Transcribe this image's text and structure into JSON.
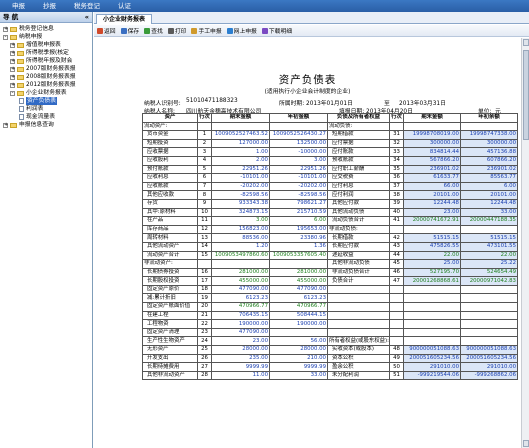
{
  "menu": [
    "申报",
    "抄报",
    "税务登记",
    "认证"
  ],
  "sidebar": {
    "title": "导 航",
    "nodes": [
      {
        "label": "税务登记信息",
        "exp": "+",
        "level": 0
      },
      {
        "label": "纳税申报",
        "exp": "-",
        "level": 0
      },
      {
        "label": "增值税申报表",
        "exp": "+",
        "level": 1
      },
      {
        "label": "所得税季报(核定",
        "exp": "+",
        "level": 1
      },
      {
        "label": "所得税年报及财会",
        "exp": "+",
        "level": 1
      },
      {
        "label": "2007版财务报表报",
        "exp": "+",
        "level": 1
      },
      {
        "label": "2008版财务报表报",
        "exp": "+",
        "level": 1
      },
      {
        "label": "2012版财务报表报",
        "exp": "+",
        "level": 1
      },
      {
        "label": "小企业财务报表",
        "exp": "-",
        "level": 1
      },
      {
        "label": "资产负债表",
        "exp": "",
        "level": 2,
        "selected": true
      },
      {
        "label": "利润表",
        "exp": "",
        "level": 2
      },
      {
        "label": "现金流量表",
        "exp": "",
        "level": 2
      },
      {
        "label": "申报信息查询",
        "exp": "+",
        "level": 0
      }
    ]
  },
  "tab": "小企业财务报表",
  "toolbar": [
    {
      "label": "返回",
      "color": "#d04a2c"
    },
    {
      "label": "保存",
      "color": "#3a6fc2"
    },
    {
      "label": "查找",
      "color": "#3a9b3a"
    },
    {
      "label": "打印",
      "color": "#5a5a5a"
    },
    {
      "label": "手工申报",
      "color": "#d09a2c"
    },
    {
      "label": "网上申报",
      "color": "#2c7fd0"
    },
    {
      "label": "下载明细",
      "color": "#7a4ac2"
    }
  ],
  "report": {
    "title": "资产负债表",
    "subtitle": "(适用执行小企业会计制度的企业)",
    "taxid_label": "纳税人识别号:",
    "taxid": "51010471188323",
    "period_label": "所属时期:",
    "period_from": "2013年01月01日",
    "period_to_label": "至",
    "period_to": "2013年03月31日",
    "name_label": "纳税人名称:",
    "name": "四川航天金穗高技术有限公司",
    "date_label": "填报日期:",
    "date": "2013年04月20日",
    "unit_label": "单位:",
    "unit": "元"
  },
  "table": {
    "headers": [
      "资产",
      "行次",
      "期末金额",
      "年初金额",
      "负债及所有者权益",
      "行次",
      "期末金额",
      "年初余额"
    ],
    "rows": [
      [
        "流动资产:",
        "",
        "",
        "",
        "流动负债:",
        "",
        "",
        ""
      ],
      [
        "货币资金",
        "1",
        "1009052527463.52",
        "1009052526430.27",
        "短期借款",
        "31",
        "19998708019.00",
        "19998747338.00"
      ],
      [
        "短期投资",
        "2",
        "127000.00",
        "132500.00",
        "应付票据",
        "32",
        "300000.00",
        "300000.00"
      ],
      [
        "应收票据",
        "3",
        "1.00",
        "-10000.00",
        "应付账款",
        "33",
        "834814.44",
        "457136.88"
      ],
      [
        "应收股利",
        "4",
        "2.00",
        "3.00",
        "预收账款",
        "34",
        "567866.20",
        "607866.20"
      ],
      [
        "预付账款",
        "5",
        "22951.26",
        "22951.26",
        "应付职工薪酬",
        "35",
        "236901.02",
        "236901.02"
      ],
      [
        "应收利息",
        "6",
        "-10101.00",
        "-10101.00",
        "应交税费",
        "36",
        "61633.77",
        "85563.77"
      ],
      [
        "应收账款",
        "7",
        "-20202.00",
        "-20202.00",
        "应付利息",
        "37",
        "66.00",
        "6.00"
      ],
      [
        "其他应收款",
        "8",
        "-82598.56",
        "-82598.56",
        "应付利润",
        "38",
        "20101.00",
        "20101.00"
      ],
      [
        "存货",
        "9",
        "933343.38",
        "798621.27",
        "其他应付款",
        "39",
        "12244.48",
        "12244.48"
      ],
      [
        "其中:原材料",
        "10",
        "324873.15",
        "215710.59",
        "其他流动负债",
        "40",
        "23.00",
        "33.00"
      ],
      [
        "在产品",
        "11",
        "3.00",
        "6.00",
        "流动负债合计",
        "41",
        "2000074167​2.91",
        "2000044718​8.35"
      ],
      [
        "库存商品",
        "12",
        "156823.00",
        "195653.00",
        "非流动负债:",
        "",
        "",
        ""
      ],
      [
        "周转材料",
        "13",
        "88536.00",
        "23380.96",
        "长期借款",
        "42",
        "51515.15",
        "51515.15"
      ],
      [
        "其他流动资产",
        "14",
        "1.20",
        "1.36",
        "长期应付款",
        "43",
        "475826.55",
        "473101.55"
      ],
      [
        "流动资产合计",
        "15",
        "1009053497860.60",
        "1009053357605.40",
        "递延收益",
        "44",
        "22.00",
        "22.00"
      ],
      [
        "非流动资产:",
        "",
        "",
        "",
        "其他非流动负债",
        "45",
        "25.00",
        "25.22"
      ],
      [
        "长期债券投资",
        "16",
        "281000.00",
        "281000.00",
        "非流动负债合计",
        "46",
        "527195.70",
        "524654.49"
      ],
      [
        "长期股权投资",
        "17",
        "455000.00",
        "455000.00",
        "负债合计",
        "47",
        "20001268868.61",
        "20000971042.83"
      ],
      [
        "固定资产原价",
        "18",
        "477090.00",
        "477090.00",
        "",
        "",
        "",
        ""
      ],
      [
        "减:累计折旧",
        "19",
        "6123.23",
        "6123.23",
        "",
        "",
        "",
        ""
      ],
      [
        "固定资产账面价值",
        "20",
        "470966.77",
        "470966.77",
        "",
        "",
        "",
        ""
      ],
      [
        "在建工程",
        "21",
        "706435.15",
        "508444.15",
        "",
        "",
        "",
        ""
      ],
      [
        "工程物资",
        "22",
        "190000.00",
        "190000.00",
        "",
        "",
        "",
        ""
      ],
      [
        "固定资产清理",
        "23",
        "477090.00",
        "",
        "",
        "",
        "",
        ""
      ],
      [
        "生产性生物资产",
        "24",
        "23.00",
        "56.00",
        "所有者权益(或股东权益):",
        "",
        "",
        ""
      ],
      [
        "无形资产",
        "25",
        "28000.00",
        "28000.00",
        "实收资本(或股本)",
        "48",
        "900000051​088.63",
        "900000051​088.63"
      ],
      [
        "开发支出",
        "26",
        "235.00",
        "210.00",
        "资本公积",
        "49",
        "200051605234.56",
        "200051605234.56"
      ],
      [
        "长期待摊费用",
        "27",
        "9999.99",
        "9999.99",
        "盈余公积",
        "50",
        "291010.00",
        "291010.00"
      ],
      [
        "其他非流动资产",
        "28",
        "11.00",
        "33.00",
        "未分配利润",
        "51",
        "-999219544.06",
        "-999268862.06"
      ]
    ]
  }
}
